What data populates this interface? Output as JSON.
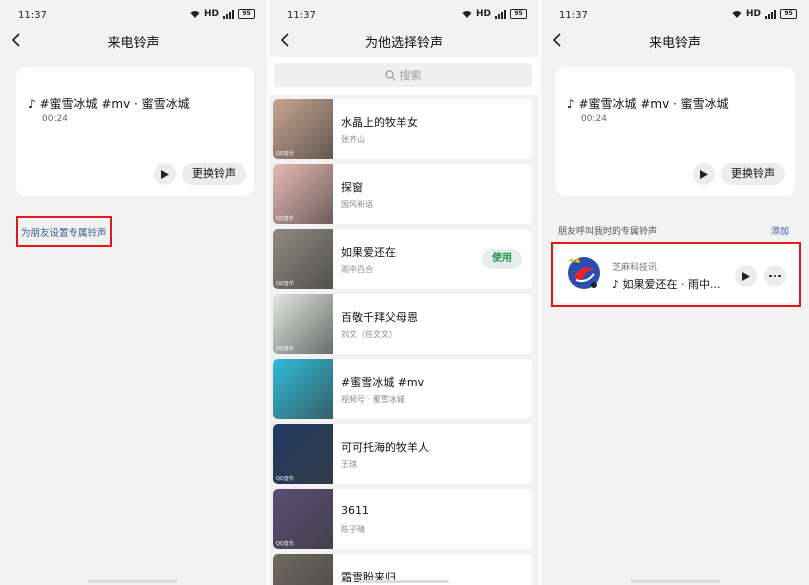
{
  "status_bar": {
    "time": "11:37",
    "network": "HD",
    "battery": "95"
  },
  "screen1": {
    "title": "来电铃声",
    "song_title": "♪ #蜜雪冰城 #mv · 蜜雪冰城",
    "duration": "00:24",
    "change_button": "更换铃声",
    "friend_link": "为朋友设置专属铃声"
  },
  "screen2": {
    "title": "为他选择铃声",
    "search_placeholder": "搜索",
    "use_button": "使用",
    "items": [
      {
        "title": "水晶上的牧羊女",
        "artist": "张齐山",
        "cover_label": "QQ音乐",
        "cover_color": "#c7a48f"
      },
      {
        "title": "探窗",
        "artist": "国风新语",
        "cover_label": "QQ音乐",
        "cover_color": "#e7b9b3"
      },
      {
        "title": "如果爱还在",
        "artist": "雨中百合",
        "cover_label": "QQ音乐",
        "cover_color": "#8f8b80"
      },
      {
        "title": "百敬千拜父母恩",
        "artist": "刘文（任文文）",
        "cover_label": "QQ音乐",
        "cover_color": "#dfe7e1"
      },
      {
        "title": "#蜜雪冰城 #mv",
        "artist": "视频号 · 蜜雪冰城",
        "cover_label": "",
        "cover_color": "#2fbbd9"
      },
      {
        "title": "可可托海的牧羊人",
        "artist": "王琪",
        "cover_label": "QQ音乐",
        "cover_color": "#1f3a63"
      },
      {
        "title": "3611",
        "artist": "陈子晴",
        "cover_label": "QQ音乐",
        "cover_color": "#5a4f76"
      },
      {
        "title": "霜雪盼来归",
        "artist": "",
        "cover_label": "",
        "cover_color": "#6f6a61"
      }
    ]
  },
  "screen3": {
    "title": "来电铃声",
    "song_title": "♪ #蜜雪冰城 #mv · 蜜雪冰城",
    "duration": "00:24",
    "change_button": "更换铃声",
    "section_label": "朋友呼叫我时的专属铃声",
    "add_link": "添加",
    "friend": {
      "name": "芝麻科技讯",
      "song": "♪ 如果爱还在 · 雨中..."
    }
  },
  "colors": {
    "accent_green": "#1f9a4a",
    "link_blue": "#3b5c94",
    "highlight_red": "#e0191e"
  },
  "icons": [
    "back-icon",
    "play-icon",
    "search-icon",
    "wifi-icon",
    "signal-icon",
    "battery-icon",
    "more-icon",
    "avatar-logo"
  ]
}
